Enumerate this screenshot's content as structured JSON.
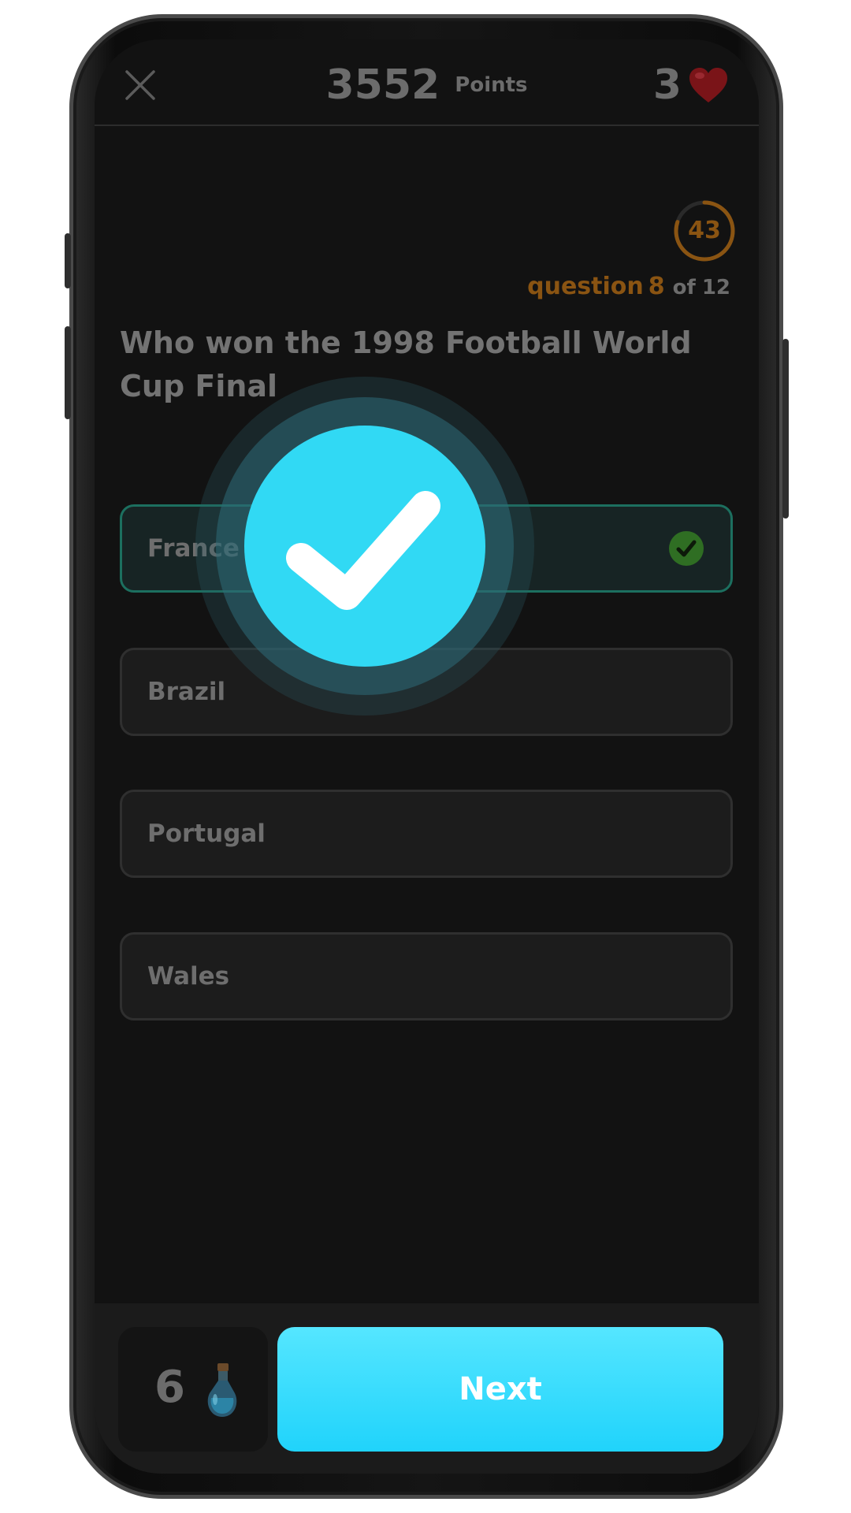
{
  "header": {
    "points_value": "3552",
    "points_label": "Points",
    "lives_count": "3",
    "close_icon": "close-icon",
    "heart_icon": "heart-icon"
  },
  "timer": {
    "seconds_left": "43",
    "ring_fraction": 0.8,
    "accent_color": "#8a5412"
  },
  "progress": {
    "word": "question",
    "current": "8",
    "of_label": "of",
    "total": "12"
  },
  "question": {
    "text": "Who won the 1998 Football World Cup Final"
  },
  "answers": [
    {
      "label": "France",
      "state": "correct"
    },
    {
      "label": "Brazil",
      "state": "default"
    },
    {
      "label": "Portugal",
      "state": "default"
    },
    {
      "label": "Wales",
      "state": "default"
    }
  ],
  "feedback": {
    "icon": "checkmark-icon",
    "result": "correct",
    "color": "#31d9f4"
  },
  "footer": {
    "hint_count": "6",
    "hint_icon": "potion-icon",
    "next_label": "Next"
  },
  "colors": {
    "background": "#121212",
    "accent_cyan": "#31d9f4",
    "correct_border": "#1c6f5f"
  }
}
